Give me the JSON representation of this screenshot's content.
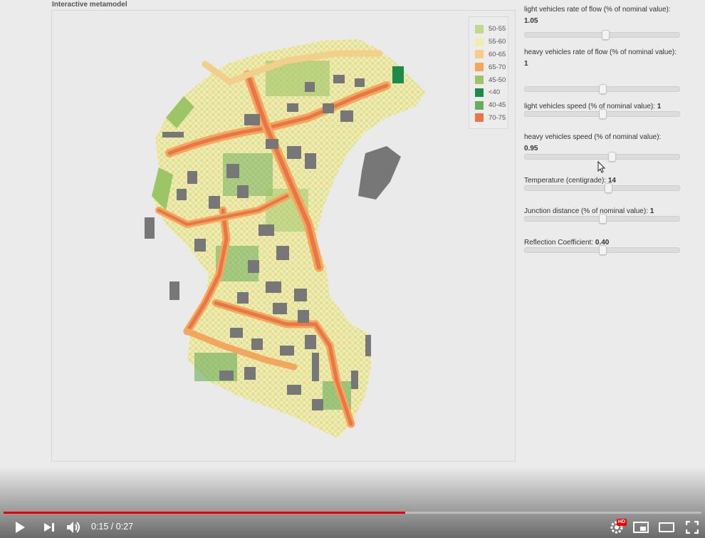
{
  "title": "Interactive metamodel",
  "legend": [
    {
      "label": "50-55",
      "color": "#c2d98a"
    },
    {
      "label": "55-60",
      "color": "#efeeb0"
    },
    {
      "label": "60-65",
      "color": "#f2cf8a"
    },
    {
      "label": "65-70",
      "color": "#f3a65d"
    },
    {
      "label": "45-50",
      "color": "#9cc567"
    },
    {
      "label": "<40",
      "color": "#1e8a4a"
    },
    {
      "label": "40-45",
      "color": "#67ad5c"
    },
    {
      "label": "70-75",
      "color": "#ea7546"
    }
  ],
  "controls": [
    {
      "label": "light vehicles rate of flow (% of nominal value):",
      "value": "1.05",
      "fraction": 0.52
    },
    {
      "label": "heavy vehicles rate of flow (% of nominal value):",
      "value": "1",
      "fraction": 0.5
    },
    {
      "label": "light vehicles speed (% of nominal value):",
      "value": "1",
      "fraction": 0.5
    },
    {
      "label": "heavy vehicles speed (% of nominal value):",
      "value": "0.95",
      "fraction": 0.56
    },
    {
      "label": "Temperature (centigrade):",
      "value": "14",
      "fraction": 0.54
    },
    {
      "label": "Junction distance (% of nominal value):",
      "value": "1",
      "fraction": 0.5
    },
    {
      "label": "Reflection Coefficient:",
      "value": "0.40",
      "fraction": 0.5
    }
  ],
  "player": {
    "current_time": "0:15",
    "duration": "0:27",
    "time_text": "0:15 / 0:27",
    "progress_fraction": 0.575,
    "hd_badge": "HD",
    "icons": {
      "play": "play-icon",
      "next": "next-icon",
      "volume": "volume-icon",
      "settings": "settings-icon",
      "miniplayer": "miniplayer-icon",
      "theater": "theater-icon",
      "fullscreen": "fullscreen-icon"
    }
  },
  "colors": {
    "progress": "#ee0000",
    "buildings": "#777777",
    "map_background": "#eaeaea"
  }
}
